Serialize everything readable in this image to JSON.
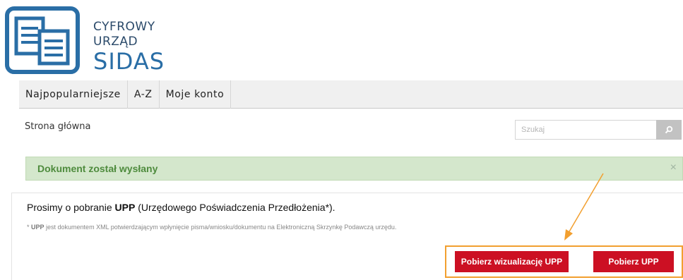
{
  "logo": {
    "line1": "CYFROWY",
    "line2": "URZĄD",
    "line3": "SIDAS",
    "icon": "documents-logo-icon"
  },
  "nav": {
    "items": [
      {
        "label": "Najpopularniejsze"
      },
      {
        "label": "A-Z"
      },
      {
        "label": "Moje konto"
      }
    ]
  },
  "breadcrumb": "Strona główna",
  "search": {
    "placeholder": "Szukaj",
    "icon": "search-icon"
  },
  "alert": {
    "text": "Dokument został wysłany",
    "close": "×"
  },
  "main": {
    "message_before": "Prosimy o pobranie ",
    "message_bold": "UPP",
    "message_after": " (Urzędowego Poświadczenia Przedłożenia*).",
    "note_prefix": "* ",
    "note_bold": "UPP",
    "note_text": " jest dokumentem XML potwierdzającym wpłynięcie pisma/wniosku/dokumentu na Elektroniczną Skrzynkę Podawczą urzędu."
  },
  "buttons": {
    "download_visualization": "Pobierz wizualizację UPP",
    "download_upp": "Pobierz UPP"
  },
  "colors": {
    "brand_blue": "#2a6ea6",
    "alert_green": "#4e8b3d",
    "alert_bg": "#d4e7cc",
    "button_red": "#cc1023",
    "highlight_orange": "#f29f2f"
  }
}
